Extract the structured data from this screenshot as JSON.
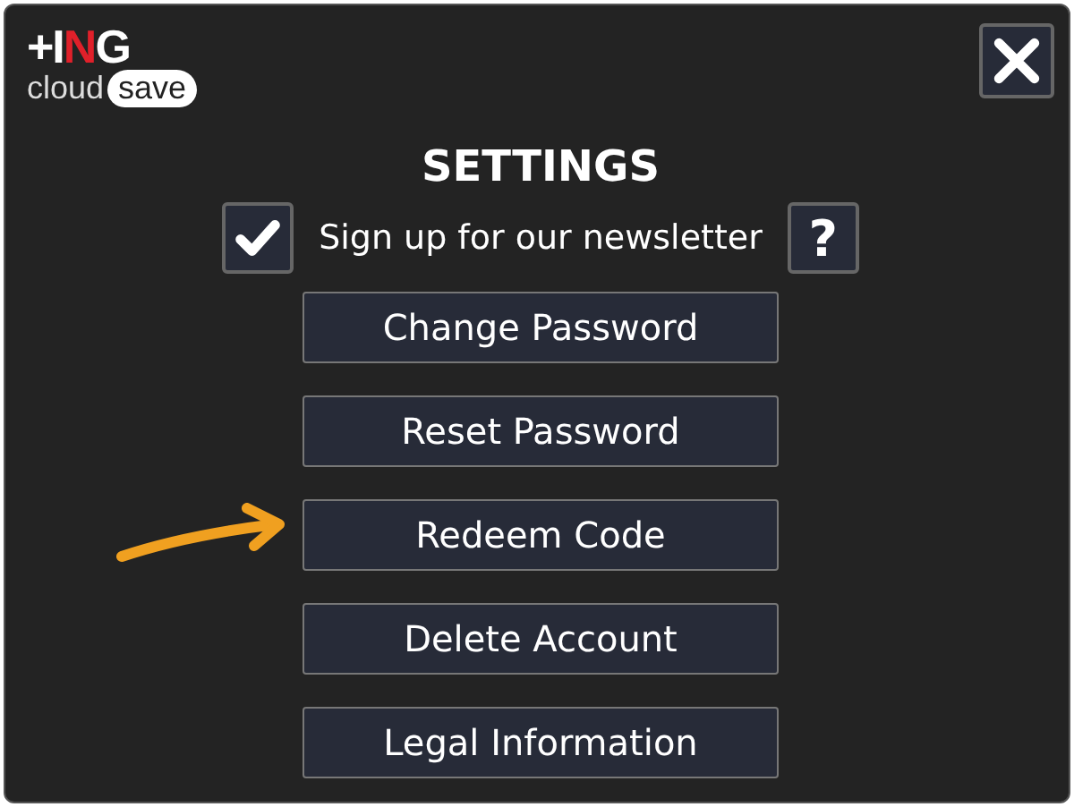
{
  "logo": {
    "parts": [
      {
        "text": "+I",
        "color": "#ffffff"
      },
      {
        "text": "N",
        "color": "#e0202a"
      },
      {
        "text": "G",
        "color": "#ffffff"
      }
    ],
    "sub": "cloud",
    "badge": "save"
  },
  "title": "SETTINGS",
  "newsletter": {
    "label": "Sign up for our newsletter",
    "checked": true,
    "help": "?"
  },
  "buttons": [
    {
      "label": "Change Password",
      "pointed": false
    },
    {
      "label": "Reset Password",
      "pointed": false
    },
    {
      "label": "Redeem Code",
      "pointed": true
    },
    {
      "label": "Delete Account",
      "pointed": false
    },
    {
      "label": "Legal Information",
      "pointed": false
    }
  ]
}
